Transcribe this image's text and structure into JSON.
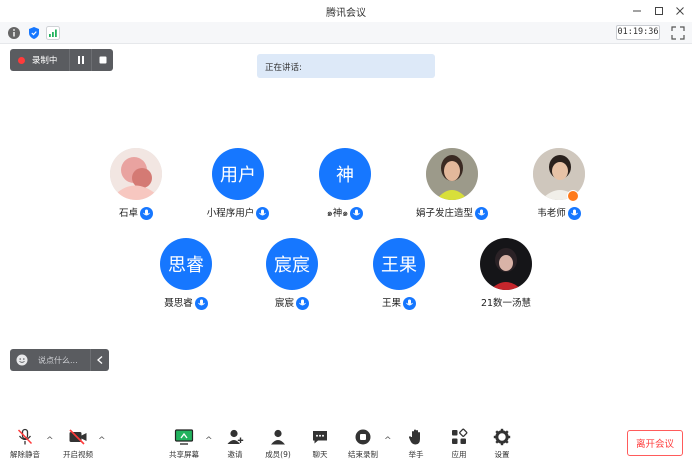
{
  "window": {
    "title": "腾讯会议"
  },
  "status": {
    "timer": "01:19:36"
  },
  "recording": {
    "label": "录制中"
  },
  "speaking": {
    "label": "正在讲话:"
  },
  "participants": [
    {
      "name": "石卓",
      "avatar_text": "",
      "photo": true
    },
    {
      "name": "小程序用户",
      "avatar_text": "用户",
      "photo": false
    },
    {
      "name": "๑神๑",
      "avatar_text": "神",
      "photo": false
    },
    {
      "name": "娟子发庄造型",
      "avatar_text": "",
      "photo": true
    },
    {
      "name": "韦老师",
      "avatar_text": "",
      "photo": true,
      "host": true
    },
    {
      "name": "聂思睿",
      "avatar_text": "思睿",
      "photo": false
    },
    {
      "name": "宸宸",
      "avatar_text": "宸宸",
      "photo": false
    },
    {
      "name": "王果",
      "avatar_text": "王果",
      "photo": false
    },
    {
      "name": "21数一汤慧",
      "avatar_text": "",
      "photo": true
    }
  ],
  "chat": {
    "placeholder": "说点什么..."
  },
  "toolbar": {
    "unmute": "解除静音",
    "start_video": "开启视频",
    "share_screen": "共享屏幕",
    "invite": "邀请",
    "members": "成员(9)",
    "chat": "聊天",
    "stop_record": "结束录制",
    "raise_hand": "举手",
    "apps": "应用",
    "settings": "设置",
    "leave": "离开会议"
  },
  "colors": {
    "accent": "#1677ff",
    "danger": "#ff3b3b"
  }
}
